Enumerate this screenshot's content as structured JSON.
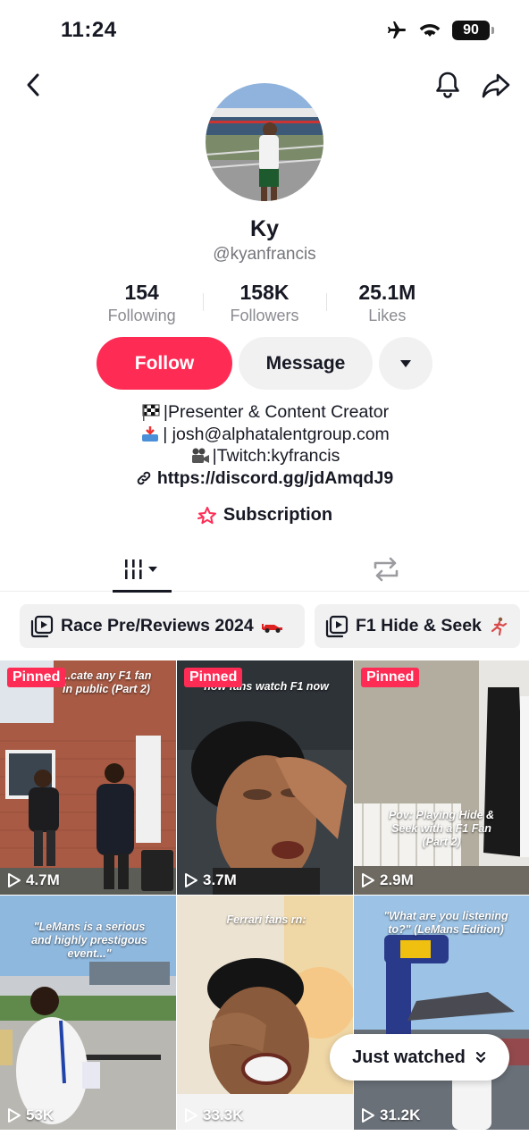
{
  "status_bar": {
    "time": "11:24",
    "battery": "90",
    "icons": [
      "airplane-icon",
      "wifi-icon",
      "battery-icon"
    ]
  },
  "profile": {
    "display_name": "Ky",
    "username": "@kyanfrancis",
    "stats": [
      {
        "value": "154",
        "label": "Following"
      },
      {
        "value": "158K",
        "label": "Followers"
      },
      {
        "value": "25.1M",
        "label": "Likes"
      }
    ],
    "actions": {
      "follow": "Follow",
      "message": "Message"
    },
    "bio": {
      "line1": "|Presenter & Content Creator",
      "line2": "| josh@alphatalentgroup.com",
      "line3": "|Twitch:kyfrancis",
      "link": "https://discord.gg/jdAmqdJ9"
    },
    "subscription": "Subscription"
  },
  "playlists": [
    {
      "label": "Race Pre/Reviews 2024"
    },
    {
      "label": "F1 Hide & Seek"
    }
  ],
  "videos": [
    {
      "pinned": "Pinned",
      "views": "4.7M",
      "caption": "...cate any F1 fan in public (Part 2)"
    },
    {
      "pinned": "Pinned",
      "views": "3.7M",
      "caption": "how fans watch F1 now"
    },
    {
      "pinned": "Pinned",
      "views": "2.9M",
      "caption": "Pov: Playing Hide & Seek with a F1 Fan (Part 2)"
    },
    {
      "views": "53K",
      "caption": "\"LeMans is a serious and highly prestigous event...\""
    },
    {
      "views": "33.3K",
      "caption": "Ferrari fans rn:"
    },
    {
      "views": "31.2K",
      "caption": "\"What are you listening to?\" (LeMans Edition)"
    }
  ],
  "just_watched": "Just watched",
  "colors": {
    "accent": "#fe2c55",
    "button_gray": "#f1f1f2",
    "muted_text": "#8a8b91"
  }
}
